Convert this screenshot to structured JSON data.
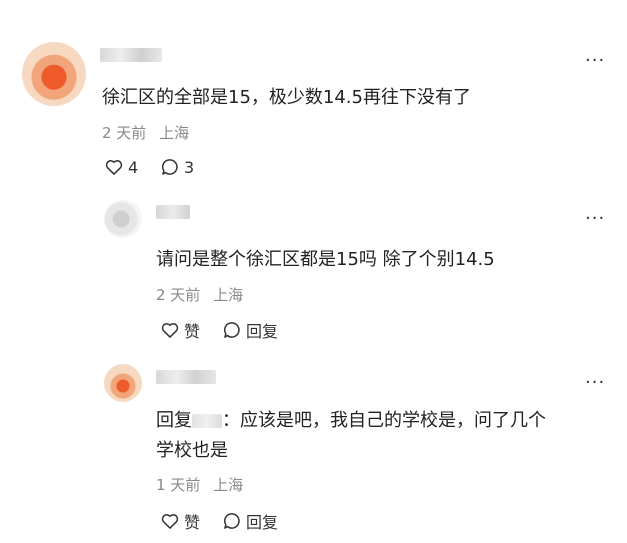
{
  "comments": [
    {
      "text": "徐汇区的全部是15，极少数14.5再往下没有了",
      "time": "2 天前",
      "location": "上海",
      "likes": "4",
      "replies": "3",
      "more": "···"
    },
    {
      "text": "请问是整个徐汇区都是15吗 除了个别14.5",
      "time": "2 天前",
      "location": "上海",
      "like_label": "赞",
      "reply_label": "回复",
      "more": "···"
    },
    {
      "reply_prefix": "回复",
      "text_line1": "：应该是吧，我自己的学校是，问了几个",
      "text_line2": "学校也是",
      "time": "1 天前",
      "location": "上海",
      "like_label": "赞",
      "reply_label": "回复",
      "more": "···"
    }
  ],
  "colors": {
    "meta": "#8a8a8a",
    "text": "#222222",
    "avatar1": "#f0a87a",
    "avatar_accent": "#ee5a2a"
  }
}
